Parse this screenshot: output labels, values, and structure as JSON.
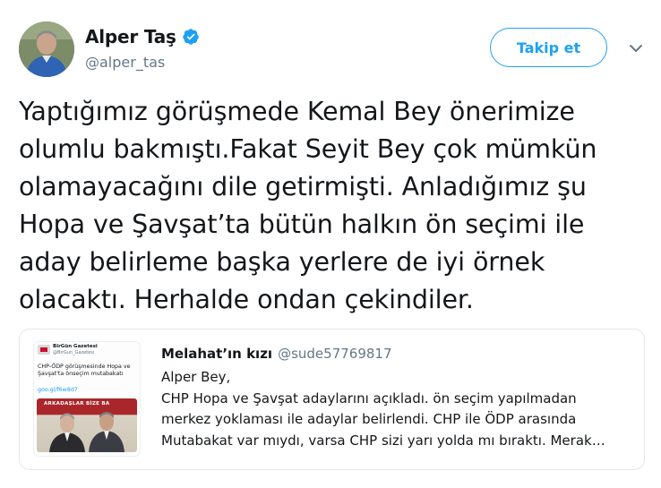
{
  "author": {
    "name": "Alper Taş",
    "handle": "@alper_tas",
    "verified": true,
    "avatar_icon": "profile-photo"
  },
  "actions": {
    "follow_label": "Takip et",
    "more_icon": "chevron-down-icon"
  },
  "tweet": {
    "text": "Yaptığımız görüşmede Kemal Bey önerimize\nolumlu bakmıştı.Fakat Seyit Bey çok mümkün\nolamayacağını dile getirmişti. Anladığımız şu\nHopa ve Şavşat’ta bütün halkın ön seçimi ile\naday belirleme başka yerlere de iyi örnek\nolacaktı. Herhalde ondan çekindiler."
  },
  "quoted": {
    "author_name": "Melahat’ın kızı",
    "author_handle": "@sude57769817",
    "text": "Alper Bey,\nCHP Hopa ve Şavşat adaylarını açıkladı. ön seçim yapılmadan\nmerkez yoklaması ile adaylar belirlendi. CHP ile ÖDP arasında\nMutabakat var mıydı, varsa CHP sizi yarı yolda mı bıraktı. Merak…",
    "media": {
      "source_name": "BirGün Gazetesi",
      "source_handle": "@BirGun_Gazetesi",
      "headline": "CHP-ÖDP görüşmesinde Hopa ve Şavşat'ta önseçim mutabakatı",
      "link": "goo.gl/f6w8d7",
      "banner": "ARKADAŞLAR BİZE BA"
    }
  },
  "colors": {
    "accent": "#1da1f2",
    "text": "#14171a",
    "secondary": "#657786",
    "border": "#e1e8ed"
  }
}
